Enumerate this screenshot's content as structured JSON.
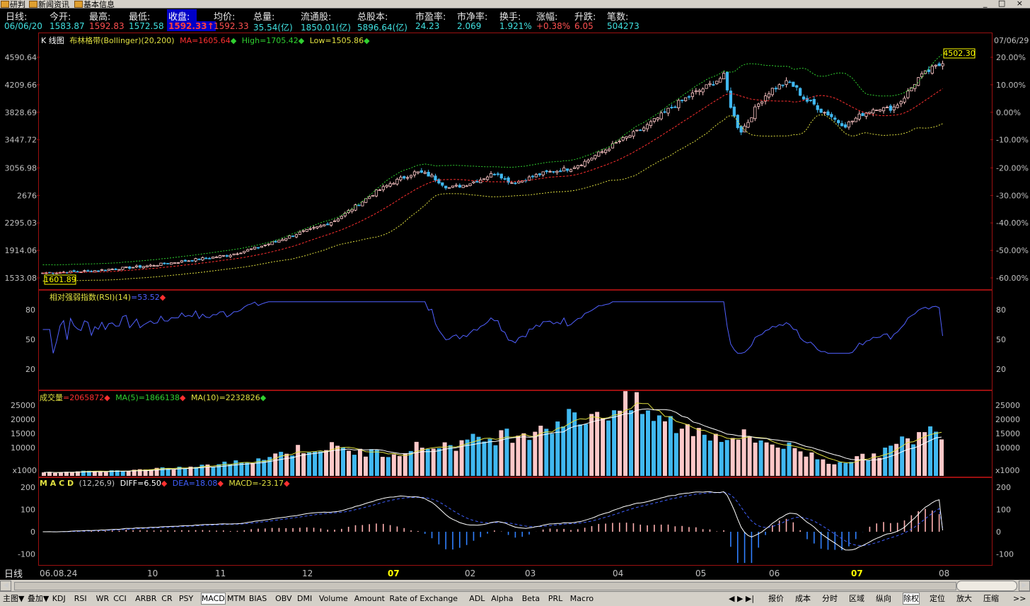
{
  "topbar": {
    "tabs": [
      "研判",
      "新闻资讯",
      "基本信息"
    ],
    "controls": "_ □ ×"
  },
  "quote": {
    "labels": [
      "日线:",
      "今开:",
      "最高:",
      "最低:",
      "收盘:",
      "均价:",
      "总量:",
      "流通股:",
      "总股本:",
      "市盈率:",
      "市净率:",
      "换手:",
      "涨幅:",
      "升跌:",
      "笔数:"
    ],
    "values": [
      "06/06/20",
      "1583.87",
      "1592.83",
      "1572.58",
      "1592.33↑",
      "1592.33",
      "35.54(亿)",
      "1850.01(亿)",
      "5896.64(亿)",
      "24.23",
      "2.069",
      "1.921%",
      "+0.38%",
      "6.05",
      "504273"
    ],
    "value_colors": [
      "#40e0e0",
      "#40e0e0",
      "#ff5050",
      "#40e0e0",
      "#ff4040",
      "#ff5050",
      "#40e0e0",
      "#40e0e0",
      "#40e0e0",
      "#40e0e0",
      "#40e0e0",
      "#40e0e0",
      "#ff5050",
      "#ff5050",
      "#40e0e0"
    ]
  },
  "kpanel": {
    "title": "K 线图",
    "indicator": "布林格带(Bollinger)(20,200)",
    "ma": "MA=1605.64",
    "high": "High=1705.42",
    "low": "Low=1505.86",
    "date_top_right": "07/06/29",
    "last_price_box": "4502.30",
    "first_price_box": "1601.89"
  },
  "rsipanel": {
    "title": "相对强弱指数(RSI)(14)",
    "value": "=53.52"
  },
  "volpanel": {
    "title": "成交量",
    "value": "=2065872",
    "ma5": "MA(5)=1866138",
    "ma10": "MA(10)=2232826",
    "unit": "x1000"
  },
  "macdpanel": {
    "title": "M A C D",
    "params": "(12,26,9)",
    "diff": "DIFF=6.50",
    "dea": "DEA=18.08",
    "macd": "MACD=-23.17"
  },
  "xaxis": {
    "period": "日线",
    "labels": [
      "06.08.24",
      "10",
      "11",
      "12",
      "07",
      "02",
      "03",
      "04",
      "05",
      "06",
      "07",
      "08"
    ],
    "highlight": "07"
  },
  "bottombar": {
    "left": [
      "主图▼",
      "叠加▼",
      "KDJ",
      "RSI",
      "WR",
      "CCI",
      "ARBR",
      "CR",
      "PSY",
      "MACD",
      "MTM",
      "BIAS",
      "OBV",
      "DMI",
      "Volume",
      "Amount",
      "Rate of Exchange",
      "ADL",
      "Alpha",
      "Beta",
      "PRL",
      "Macro"
    ],
    "selected": "MACD",
    "right": [
      "报价",
      "成本",
      "分时",
      "区域",
      "纵向",
      "除权",
      "定位",
      "放大",
      "压缩"
    ],
    "right_selected": "除权"
  },
  "chart_data": [
    {
      "type": "candlestick",
      "title": "K 线图",
      "y_ticks": [
        4590.64,
        4209.66,
        3828.69,
        3447.72,
        3056.98,
        2676,
        2295.03,
        1914.06,
        1533.08
      ],
      "y_pct_ticks": [
        "20.00%",
        "10.00%",
        "0.00%",
        "-10.00%",
        "-20.00%",
        "-30.00%",
        "-40.00%",
        "-50.00%",
        "-60.00%"
      ],
      "ylim": [
        1533.08,
        4590.64
      ],
      "close_series": [
        1601.89,
        1605,
        1610,
        1615,
        1620,
        1625,
        1630,
        1640,
        1650,
        1660,
        1670,
        1680,
        1690,
        1700,
        1715,
        1730,
        1745,
        1760,
        1775,
        1790,
        1805,
        1820,
        1835,
        1850,
        1880,
        1910,
        1940,
        1975,
        2010,
        2050,
        2090,
        2130,
        2170,
        2200,
        2240,
        2280,
        2330,
        2400,
        2480,
        2560,
        2640,
        2720,
        2780,
        2850,
        2900,
        2950,
        3000,
        2980,
        2940,
        2860,
        2780,
        2800,
        2820,
        2860,
        2900,
        2950,
        3000,
        2900,
        2850,
        2880,
        2920,
        2960,
        2990,
        3010,
        3030,
        3050,
        3100,
        3150,
        3220,
        3280,
        3350,
        3420,
        3480,
        3540,
        3600,
        3680,
        3760,
        3850,
        3930,
        4000,
        4070,
        4130,
        4190,
        4260,
        4330,
        3850,
        3550,
        3700,
        3900,
        4050,
        4150,
        4200,
        4250,
        4150,
        4000,
        3950,
        3850,
        3800,
        3700,
        3650,
        3720,
        3800,
        3850,
        3900,
        3870,
        3900,
        4000,
        4150,
        4300,
        4380,
        4450,
        4502.3
      ],
      "bollinger": {
        "period": 20,
        "mid_label": "MA=1605.64",
        "upper_label": "High=1705.42",
        "lower_label": "Low=1505.86"
      },
      "x_labels": [
        "06.08.24",
        "10",
        "11",
        "12",
        "07",
        "02",
        "03",
        "04",
        "05",
        "06",
        "07",
        "08"
      ],
      "last_value": 4502.3,
      "first_value": 1601.89
    },
    {
      "type": "line",
      "title": "相对强弱指数(RSI)(14)",
      "y_ticks": [
        80,
        50,
        20
      ],
      "ylim": [
        0,
        100
      ],
      "last_value": 53.52
    },
    {
      "type": "bar",
      "title": "成交量",
      "y_ticks": [
        25000,
        20000,
        15000,
        10000
      ],
      "unit": "x1000",
      "ylim": [
        0,
        27000
      ],
      "last_value": 2065872,
      "ma5": 1866138,
      "ma10": 2232826
    },
    {
      "type": "bar",
      "title": "M A C D (12,26,9)",
      "y_ticks": [
        200,
        100,
        0,
        -100
      ],
      "ylim": [
        -150,
        220
      ],
      "diff": 6.5,
      "dea": 18.08,
      "macd": -23.17
    }
  ],
  "colors": {
    "frame": "#9a1010",
    "up": "#ffc8c8",
    "down": "#40b8f0",
    "ma_red": "#ff3030",
    "boll_green": "#30d030",
    "boll_yellow": "#e0e040",
    "rsi": "#5060ff",
    "macd_dea": "#4060ff"
  }
}
